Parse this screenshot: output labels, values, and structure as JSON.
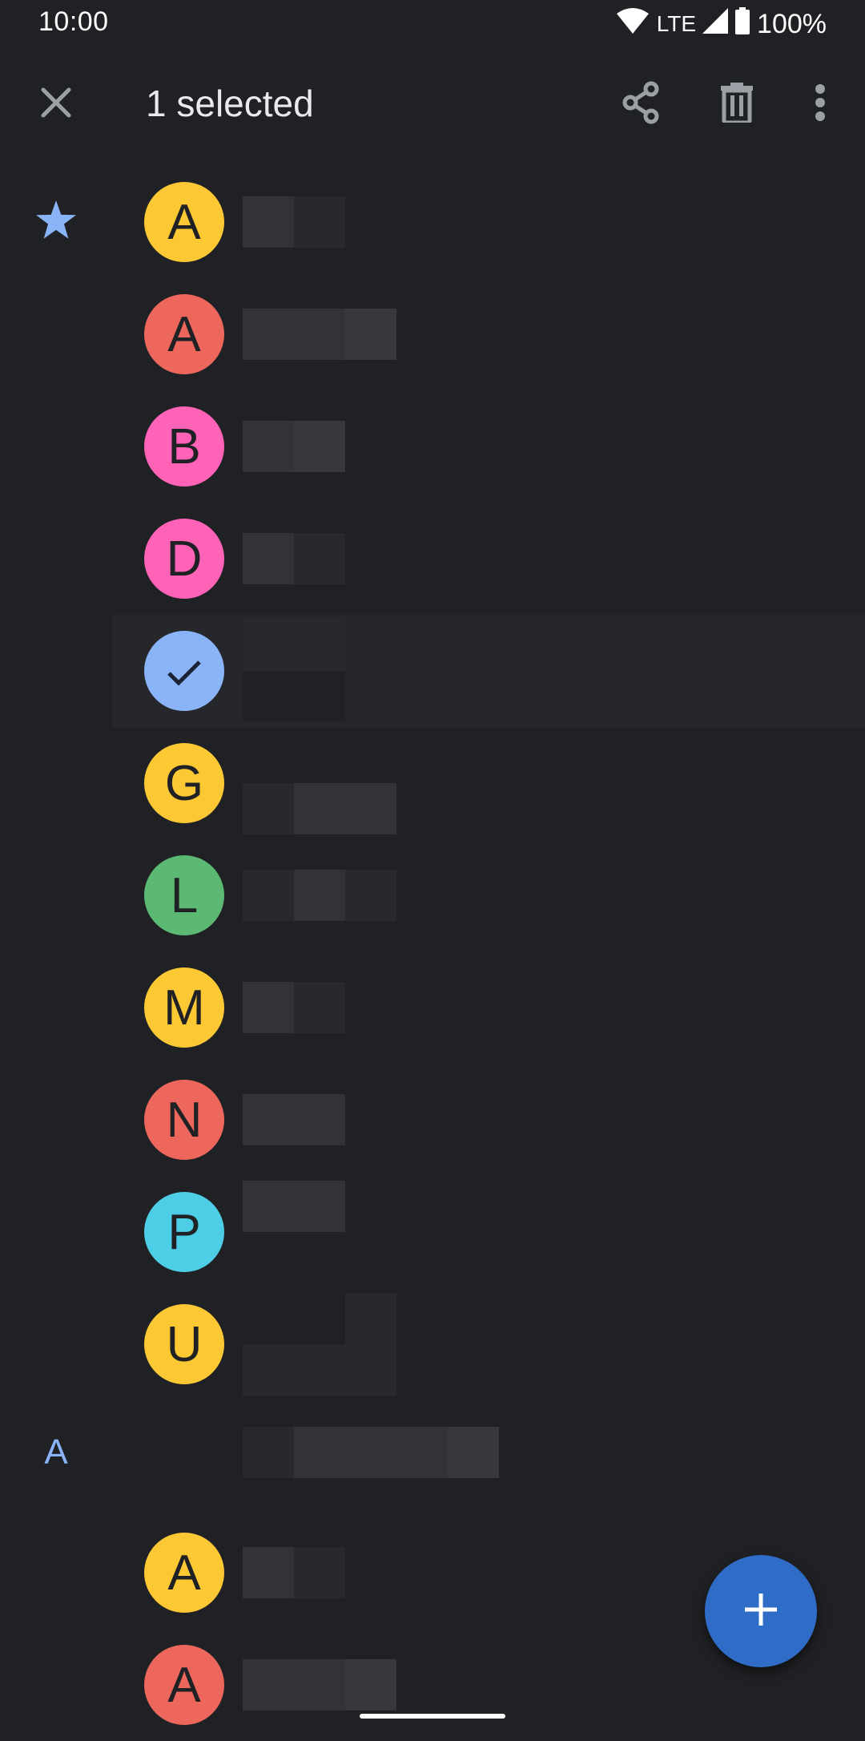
{
  "status_bar": {
    "time": "10:00",
    "network": "LTE",
    "battery": "100%",
    "icons": [
      "wifi-icon",
      "cell-signal-icon",
      "battery-icon"
    ]
  },
  "app_bar": {
    "title": "1 selected",
    "close_icon": "close-icon",
    "actions": [
      {
        "name": "share",
        "icon": "share-icon"
      },
      {
        "name": "delete",
        "icon": "trash-icon"
      },
      {
        "name": "more",
        "icon": "more-vert-icon"
      }
    ]
  },
  "colors": {
    "background": "#202124",
    "accent": "#8ab4f8",
    "fab": "#2f6cc8",
    "icon_gray": "#9aa0a6",
    "selected_row": "#26272b",
    "yellow": "#fcc934",
    "red": "#ee675c",
    "pink": "#ff63b8",
    "green": "#5bb974",
    "cyan": "#4ecde6",
    "selected_avatar": "#8ab4f8"
  },
  "contacts": [
    {
      "section": "star",
      "initial": "A",
      "color": "#fcc934",
      "name_redacted": true,
      "blur": [
        [
          2,
          1
        ]
      ]
    },
    {
      "section": "",
      "initial": "A",
      "color": "#ee675c",
      "name_redacted": true,
      "blur": [
        [
          2,
          2,
          3,
          0
        ]
      ]
    },
    {
      "section": "",
      "initial": "B",
      "color": "#ff63b8",
      "name_redacted": true,
      "blur": [
        [
          2,
          3,
          0
        ]
      ]
    },
    {
      "section": "",
      "initial": "D",
      "color": "#ff63b8",
      "name_redacted": true,
      "blur": [
        [
          2,
          1
        ]
      ]
    },
    {
      "section": "",
      "initial": "",
      "selected": true,
      "color": "#8ab4f8",
      "name_redacted": true,
      "blur": [
        [
          1,
          1
        ],
        [
          0,
          0
        ]
      ]
    },
    {
      "section": "",
      "initial": "G",
      "color": "#fcc934",
      "name_redacted": true,
      "blur": [
        [
          0,
          0,
          0
        ],
        [
          1,
          2,
          2
        ]
      ]
    },
    {
      "section": "",
      "initial": "L",
      "color": "#5bb974",
      "name_redacted": true,
      "blur": [
        [
          1,
          2,
          1
        ]
      ]
    },
    {
      "section": "",
      "initial": "M",
      "color": "#fcc934",
      "name_redacted": true,
      "blur": [
        [
          2,
          1
        ]
      ]
    },
    {
      "section": "",
      "initial": "N",
      "color": "#ee675c",
      "name_redacted": true,
      "blur": [
        [
          2,
          2
        ]
      ]
    },
    {
      "section": "",
      "initial": "P",
      "color": "#4ecde6",
      "name_redacted": true,
      "blur": [
        [
          2,
          2,
          0
        ],
        [
          0,
          0,
          0
        ]
      ]
    },
    {
      "section": "",
      "initial": "U",
      "color": "#fcc934",
      "name_redacted": true,
      "blur": [
        [
          0,
          0,
          1
        ],
        [
          1,
          1,
          1
        ]
      ]
    },
    {
      "section": "A",
      "photo": true,
      "name_redacted": true,
      "blur": [
        [
          1,
          2,
          2,
          2,
          3,
          0
        ]
      ]
    },
    {
      "section": "",
      "initial": "A",
      "color": "#fcc934",
      "name_redacted": true,
      "blur": [
        [
          2,
          1
        ]
      ]
    },
    {
      "section": "",
      "initial": "A",
      "color": "#ee675c",
      "name_redacted": true,
      "blur": [
        [
          2,
          2,
          3,
          0
        ]
      ]
    }
  ],
  "fab": {
    "label": "Create contact",
    "icon": "plus-icon"
  }
}
